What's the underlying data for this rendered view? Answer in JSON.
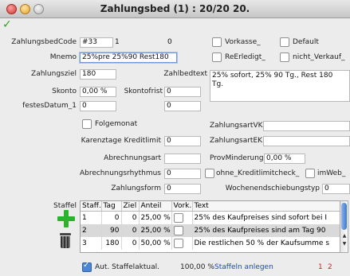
{
  "window": {
    "title": "Zahlungsbed (1) : 20/20 20."
  },
  "fields": {
    "code_label": "ZahlungsbedCode",
    "code_value": "#33",
    "code_num": "1",
    "code_zero": "0",
    "mnemo_label": "Mnemo",
    "mnemo_value": "25%pre 25%90 Rest180",
    "ziel_label": "Zahlungsziel",
    "ziel_value": "180",
    "skonto_label": "Skonto",
    "skonto_value": "0,00 %",
    "skontofrist_label": "Skontofrist",
    "skontofrist_value": "0",
    "festesdatum_label": "festesDatum_1",
    "festesdatum_value": "0",
    "festesdatum_value2": "0",
    "zahlbedtext_label": "Zahlbedtext",
    "zahlbedtext_value": "25% sofort, 25% 90 Tg., Rest 180\nTg.",
    "folgemonat_label": "Folgemonat",
    "zahlungsartvk_label": "ZahlungsartVK",
    "karenz_label": "Karenztage Kreditlimit",
    "karenz_value": "0",
    "zahlungsartek_label": "ZahlungsartEK",
    "abrechnungsart_label": "Abrechnungsart",
    "provminderung_label": "ProvMinderung",
    "provminderung_value": "0,00 %",
    "rhythmus_label": "Abrechnungsrhythmus",
    "rhythmus_value": "0",
    "ohne_kredit_label": "ohne_Kreditlimitcheck_",
    "imweb_label": "imWeb_",
    "zahlungsform_label": "Zahlungsform",
    "zahlungsform_value": "0",
    "wochenende_label": "Wochenendschiebungstyp",
    "wochenende_value": "0"
  },
  "checkboxes": {
    "vorkasse": "Vorkasse_",
    "default": "Default",
    "reerledigt": "ReErledigt_",
    "nicht_verkauf": "nicht_Verkauf_"
  },
  "staffel": {
    "label": "Staffel",
    "headers": [
      "Staff.",
      "Tag",
      "Ziel",
      "Anteil",
      "Vork.",
      "Text"
    ],
    "rows": [
      {
        "staff": "1",
        "tag": "0",
        "ziel": "0",
        "anteil": "25,00 %",
        "text": "25% des Kaufpreises sind sofort bei I"
      },
      {
        "staff": "2",
        "tag": "90",
        "ziel": "0",
        "anteil": "25,00 %",
        "text": "25% des Kaufpreises sind am Tag 90"
      },
      {
        "staff": "3",
        "tag": "180",
        "ziel": "0",
        "anteil": "50,00 %",
        "text": "Die restlichen 50 % der Kaufsumme s"
      }
    ],
    "aut_label": "Aut. Staffelaktual.",
    "total": "100,00 %",
    "anlegen_label": "Staffeln anlegen",
    "page1": "1",
    "page2": "2"
  }
}
